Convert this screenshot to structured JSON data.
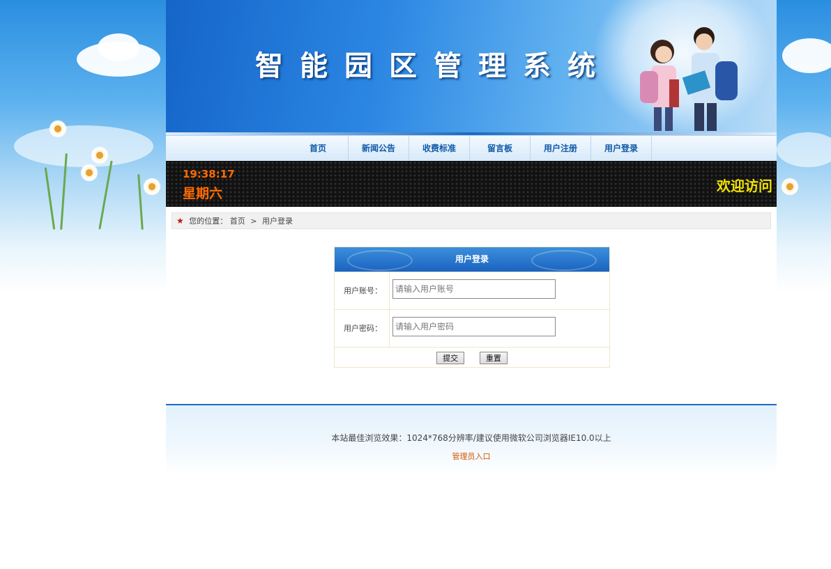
{
  "banner": {
    "title": "智能园区管理系统"
  },
  "nav": {
    "items": [
      {
        "label": "首页"
      },
      {
        "label": "新闻公告"
      },
      {
        "label": "收费标准"
      },
      {
        "label": "留言板"
      },
      {
        "label": "用户注册"
      },
      {
        "label": "用户登录"
      }
    ]
  },
  "led": {
    "time": "19:38:17",
    "day": "星期六",
    "welcome": "欢迎访问"
  },
  "breadcrumb": {
    "prefix": "您的位置：",
    "home": "首页",
    "separator": ">",
    "current": "用户登录"
  },
  "login": {
    "title": "用户登录",
    "account_label": "用户账号：",
    "account_placeholder": "请输入用户账号",
    "password_label": "用户密码：",
    "password_placeholder": "请输入用户密码",
    "submit": "提交",
    "reset": "重置"
  },
  "footer": {
    "copy": "本站最佳浏览效果：1024*768分辨率/建议使用微软公司浏览器IE10.0以上",
    "admin_link": "管理员入口"
  },
  "colors": {
    "nav_text": "#0e5aa8",
    "led_time": "#ff6a00",
    "led_welcome": "#f2e300",
    "footer_rule": "#1a6cc0",
    "admin_link": "#d05a00"
  }
}
